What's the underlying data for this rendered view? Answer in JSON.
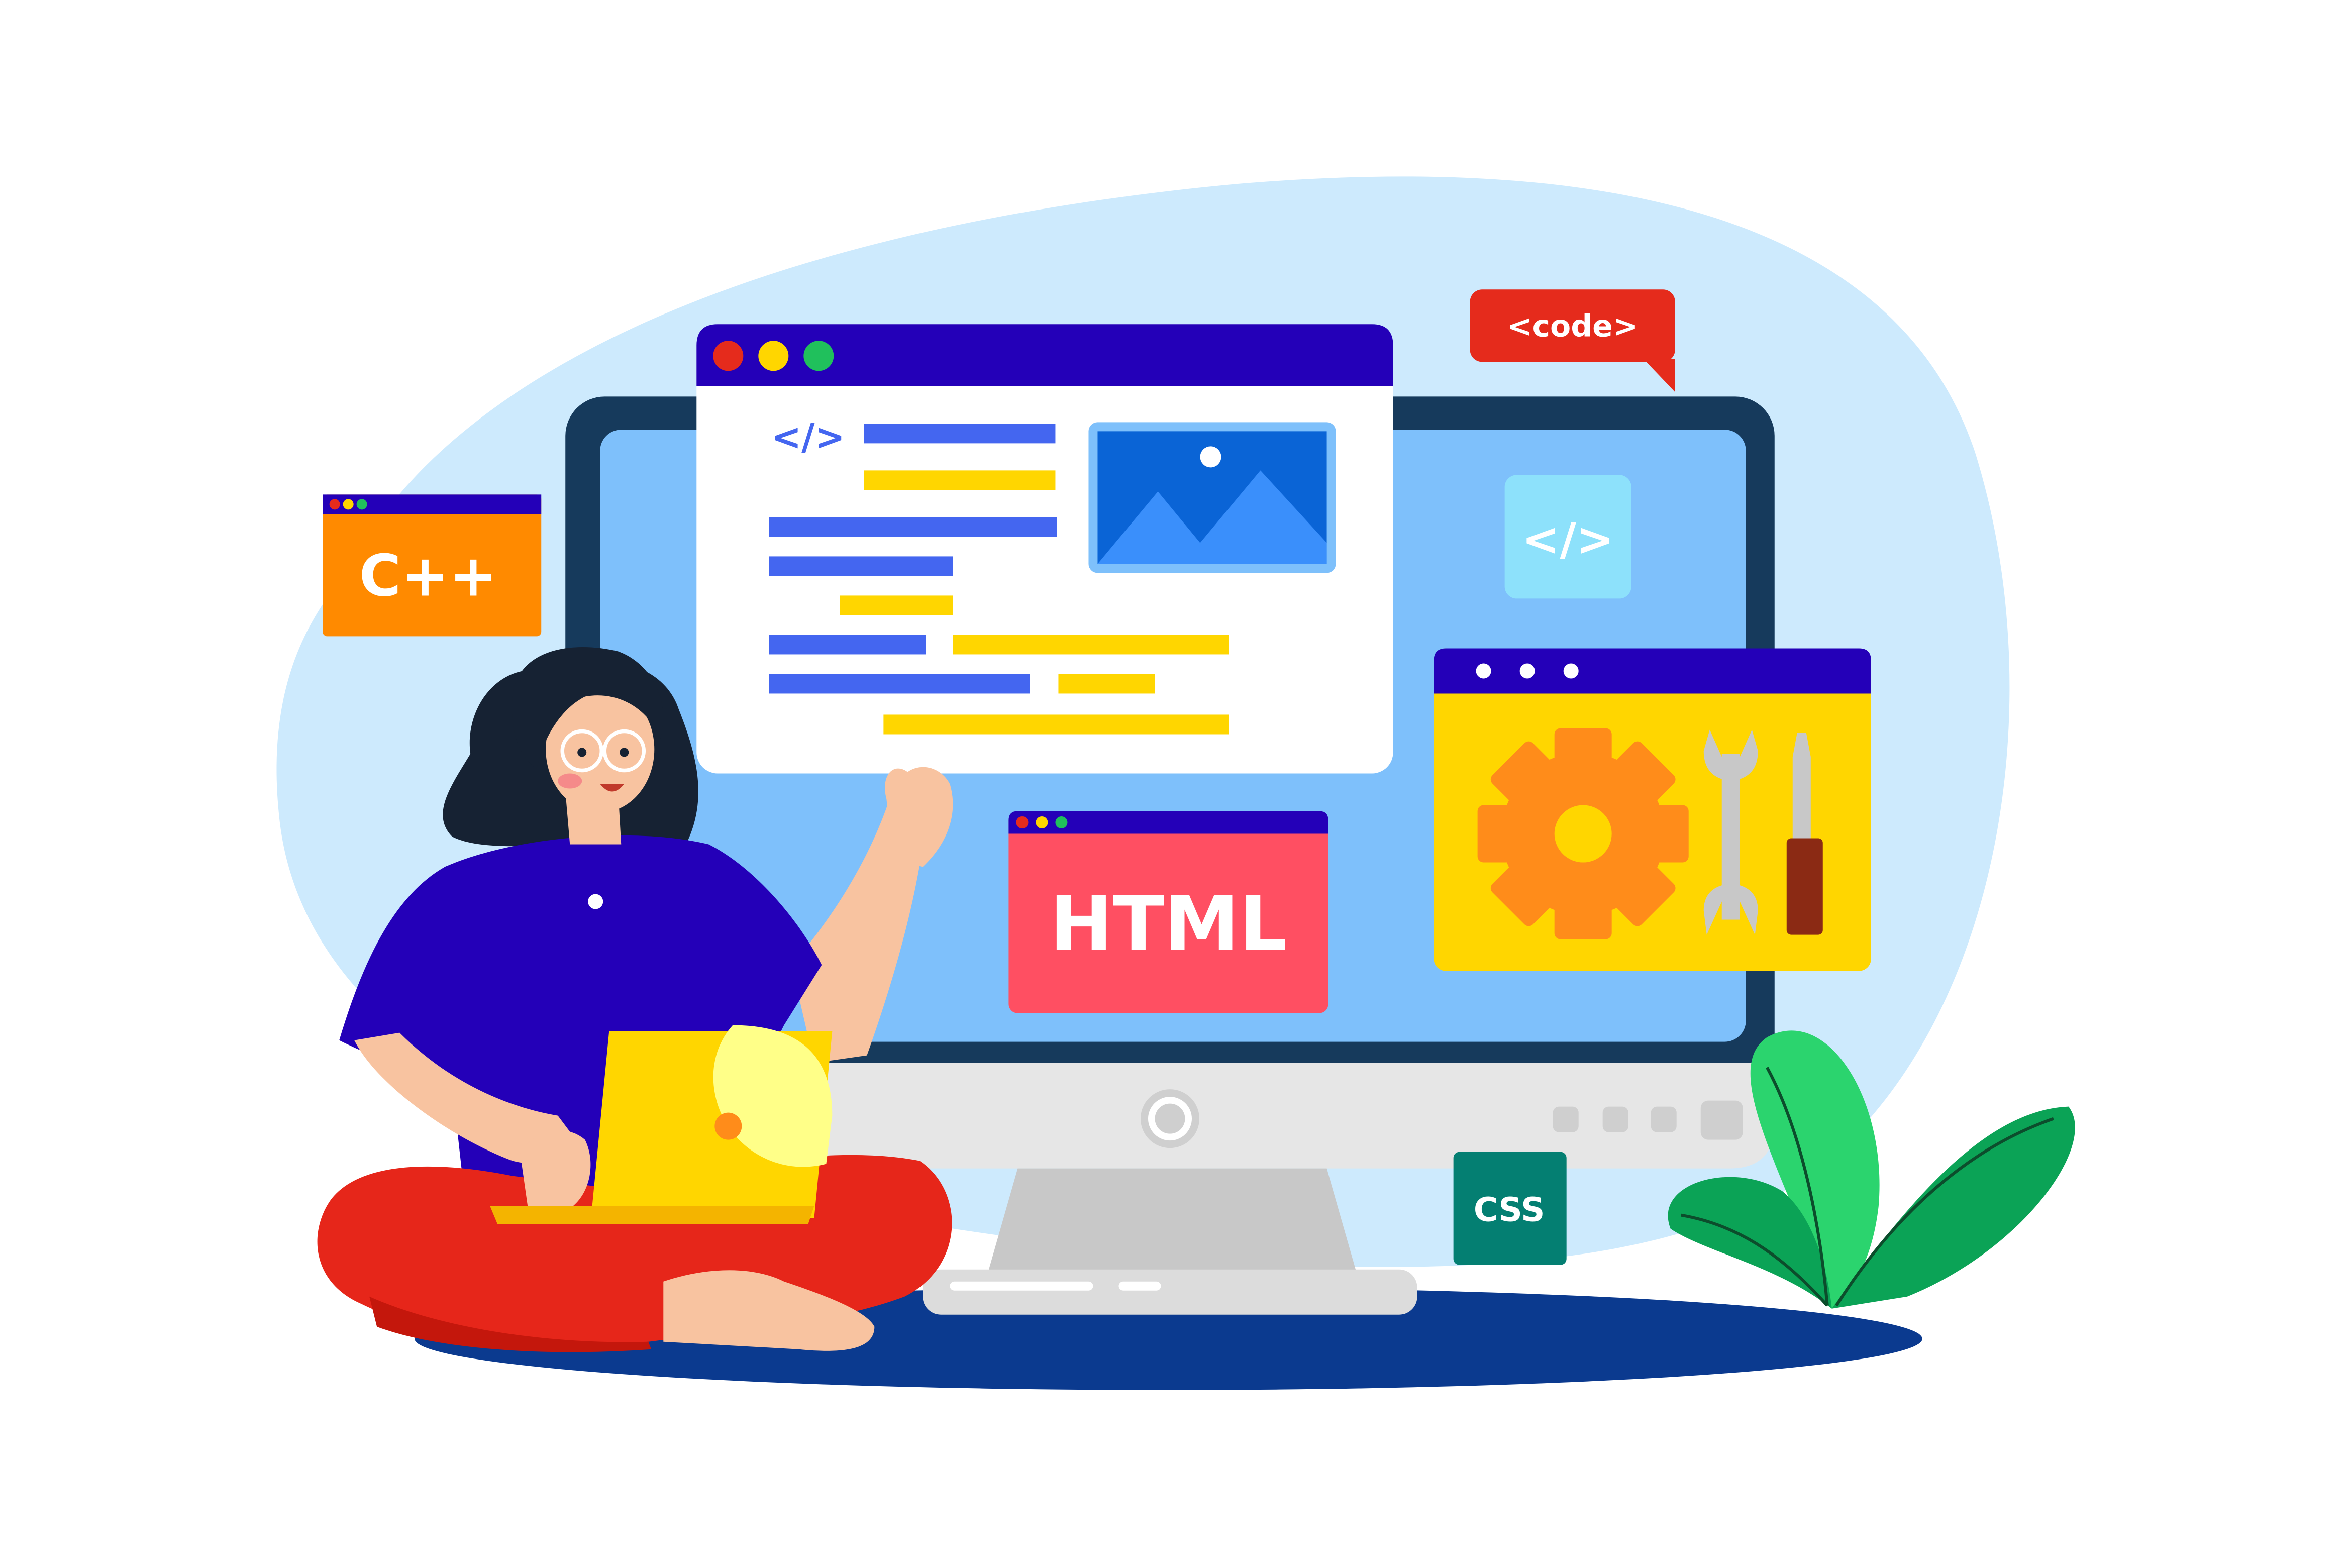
{
  "labels": {
    "cpp_badge": "C++",
    "code_bubble": "<code>",
    "code_icon_window": "</>",
    "code_icon_screen": "</>",
    "html_window": "HTML",
    "css_badge": "CSS"
  },
  "colors": {
    "background_blob": "#cdeafd",
    "floor_shadow": "#0b3a8f",
    "monitor_frame": "#163a5c",
    "monitor_screen": "#7ec0fb",
    "monitor_chin": "#e6e6e6",
    "window_titlebar": "#2400b8",
    "window_body": "#ffffff",
    "code_line_blue": "#4466f0",
    "code_line_yellow": "#ffd600",
    "cpp_orange": "#ff8a00",
    "code_bubble_red": "#e52b1c",
    "html_red": "#ff4f62",
    "css_teal": "#047f72",
    "settings_yellow": "#ffd600",
    "gear_orange": "#ff8c1a",
    "laptop_yellow": "#ffd600",
    "shirt_blue": "#2400b8",
    "pants_red": "#e6261a",
    "skin": "#f8c3a0",
    "hair": "#162233",
    "plant_green": "#2bd46e",
    "plant_dark_green": "#0ba356"
  },
  "icons": [
    "window-dots-icon",
    "image-placeholder-icon",
    "code-brackets-icon",
    "gear-icon",
    "wrench-icon",
    "screwdriver-icon",
    "power-button-icon"
  ]
}
